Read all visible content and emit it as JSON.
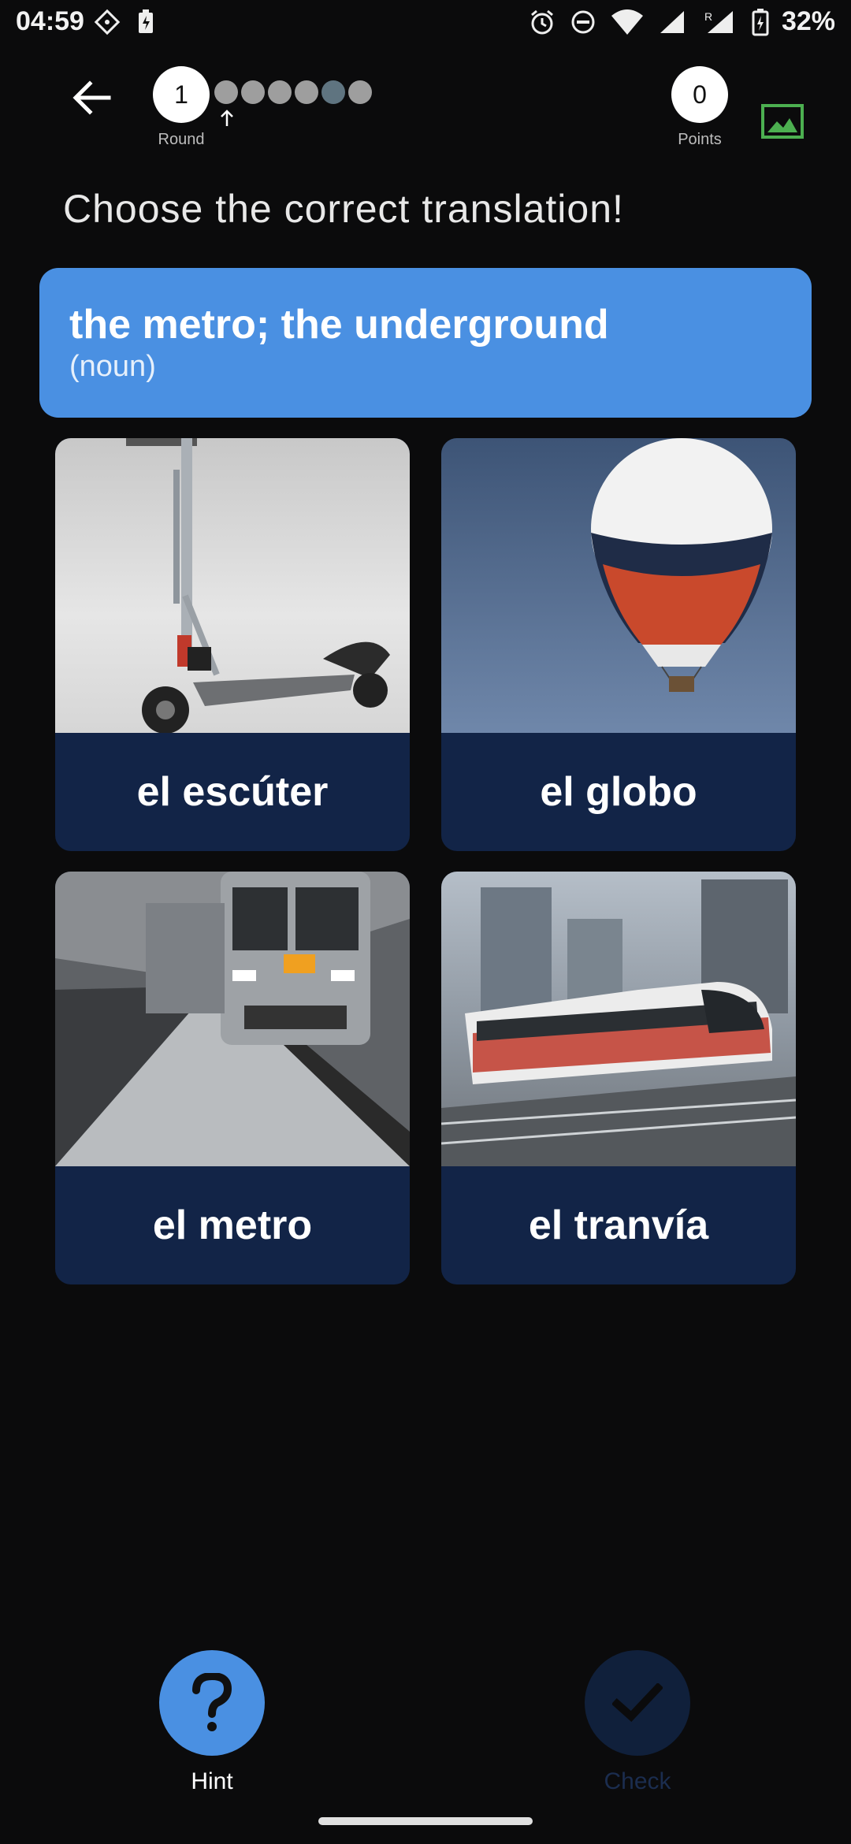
{
  "status_bar": {
    "time": "04:59",
    "battery": "32%"
  },
  "header": {
    "round_value": "1",
    "round_label": "Round",
    "points_value": "0",
    "points_label": "Points",
    "progress": {
      "total_dots": 7,
      "current_index": 0,
      "highlighted_index": 5
    }
  },
  "instruction": "Choose the correct translation!",
  "prompt": {
    "term": "the metro; the underground",
    "part_of_speech": "(noun)"
  },
  "options": [
    {
      "label": "el escúter",
      "image": "scooter"
    },
    {
      "label": "el globo",
      "image": "hot-air-balloon"
    },
    {
      "label": "el metro",
      "image": "metro-train"
    },
    {
      "label": "el tranvía",
      "image": "tram"
    }
  ],
  "actions": {
    "hint_label": "Hint",
    "check_label": "Check"
  },
  "colors": {
    "background": "#0b0b0c",
    "accent_blue": "#4a90e2",
    "option_label_bg": "#122447",
    "image_toggle_green": "#4caf50"
  }
}
